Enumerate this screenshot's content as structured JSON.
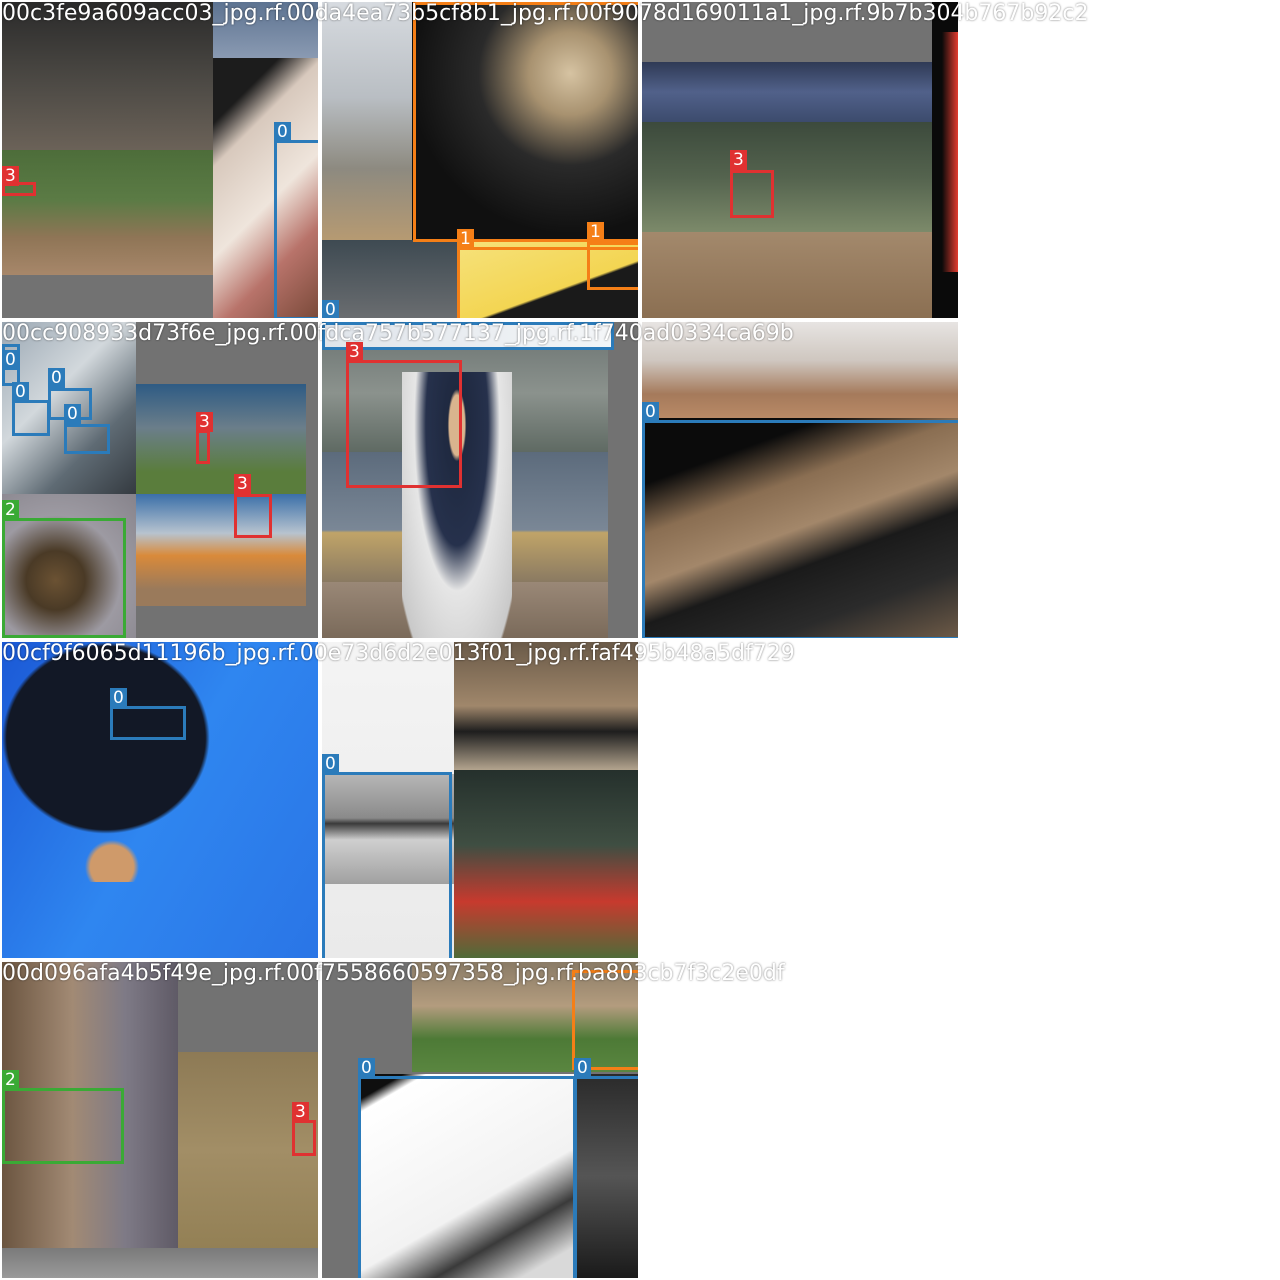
{
  "captions": [
    "00c3fe9a609acc03_jpg.rf.00da4ea73b5cf8b1_jpg.rf.00f9078d169011a1_jpg.rf.9b7b304b767b92c2",
    "00cc908933d73f6e_jpg.rf.00fdca757b577137_jpg.rf.1f740ad0334ca69b",
    "00cf9f6065d11196b_jpg.rf.00e73d6d2e013f01_jpg.rf.faf495b48a5df729",
    "00d096afa4b5f49e_jpg.rf.00f7558660597358_jpg.rf.ba803cb7f3c2e0df"
  ],
  "class_colors": {
    "0": "#2b7bba",
    "1": "#f57f17",
    "2": "#3aaa35",
    "3": "#e03131"
  },
  "tiles": [
    {
      "name": "tile-baseball-stadium",
      "boxes": [
        {
          "label": "3",
          "class": "3"
        },
        {
          "label": "0",
          "class": "0"
        }
      ]
    },
    {
      "name": "tile-rifle-closeup",
      "boxes": [
        {
          "label": "1",
          "class": "1"
        },
        {
          "label": "1",
          "class": "1"
        },
        {
          "label": "1",
          "class": "1"
        },
        {
          "label": "0",
          "class": "0"
        }
      ]
    },
    {
      "name": "tile-batter-catcher-umpire",
      "boxes": [
        {
          "label": "3",
          "class": "3"
        }
      ]
    },
    {
      "name": "tile-glass-case-knives",
      "boxes": [
        {
          "label": "0",
          "class": "0"
        },
        {
          "label": "0",
          "class": "0"
        },
        {
          "label": "0",
          "class": "0"
        },
        {
          "label": "0",
          "class": "0"
        },
        {
          "label": "0",
          "class": "0"
        },
        {
          "label": "3",
          "class": "3"
        },
        {
          "label": "3",
          "class": "3"
        },
        {
          "label": "2",
          "class": "2"
        }
      ]
    },
    {
      "name": "tile-softball-batter",
      "boxes": [
        {
          "label": "3",
          "class": "3"
        }
      ]
    },
    {
      "name": "tile-revolver-on-wood",
      "boxes": [
        {
          "label": "0",
          "class": "0"
        }
      ]
    },
    {
      "name": "tile-upside-down-person",
      "boxes": [
        {
          "label": "0",
          "class": "0"
        }
      ]
    },
    {
      "name": "tile-pistol-slide",
      "boxes": [
        {
          "label": "0",
          "class": "0"
        }
      ]
    },
    {
      "name": "tile-blurred-knife",
      "boxes": [
        {
          "label": "2",
          "class": "2"
        },
        {
          "label": "3",
          "class": "3"
        }
      ]
    },
    {
      "name": "tile-revolver-white",
      "boxes": [
        {
          "label": "1",
          "class": "1"
        },
        {
          "label": "0",
          "class": "0"
        },
        {
          "label": "0",
          "class": "0"
        }
      ]
    }
  ]
}
